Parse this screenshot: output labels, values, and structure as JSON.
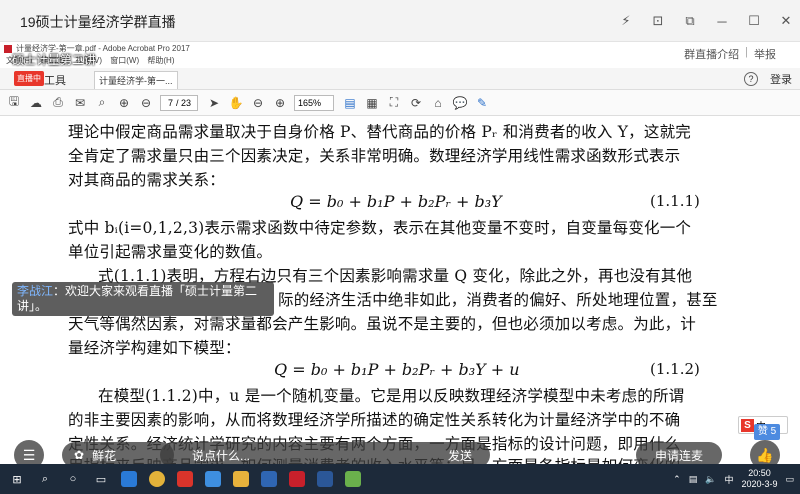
{
  "window": {
    "title": "19硕士计量经济学群直播",
    "controls": [
      "⚡",
      "⊡",
      "⧉",
      "─",
      "☐",
      "✕"
    ]
  },
  "acrobat": {
    "file_title": "计量经济学-第一章.pdf - Adobe Acrobat Pro 2017",
    "menu": [
      "文件(F)",
      "编辑(E)",
      "视图(V)",
      "窗口(W)",
      "帮助(H)"
    ],
    "stream_name": "硕士计量第二讲",
    "right_links": [
      "群直播介绍",
      "举报"
    ],
    "live_badge": "直播中",
    "tools_tab": "工具",
    "doc_tab": "计量经济学-第一...",
    "login": "登录",
    "page_current": "7",
    "page_total": "/ 23",
    "zoom": "165%"
  },
  "document": {
    "line1": "理论中假定商品需求量取决于自身价格 P、替代商品的价格 Pᵣ 和消费者的收入 Y，这就完",
    "line2": "全肯定了需求量只由三个因素决定，关系非常明确。数理经济学用线性需求函数形式表示",
    "line3": "对其商品的需求关系：",
    "eq1": "Q = b₀ + b₁P + b₂Pᵣ + b₃Y",
    "eq1_num": "(1.1.1)",
    "line4": "式中 bᵢ(i=0,1,2,3)表示需求函数中待定参数，表示在其他变量不变时，自变量每变化一个",
    "line5": "单位引起需求量变化的数值。",
    "line6": "式(1.1.1)表明，方程右边只有三个因素影响需求量 Q 变化，除此之外，再也没有其他",
    "line7": "际的经济生活中绝非如此，消费者的偏好、所处地理位置，甚至",
    "line8": "天气等偶然因素，对需求量都会产生影响。虽说不是主要的，但也必须加以考虑。为此，计",
    "line9": "量经济学构建如下模型：",
    "eq2": "Q = b₀ + b₁P + b₂Pᵣ + b₃Y + u",
    "eq2_num": "(1.1.2)",
    "line10": "在模型(1.1.2)中，u 是一个随机变量。它是用以反映数理经济学模型中未考虑的所谓",
    "line11": "的非主要因素的影响，从而将数理经济学所描述的确定性关系转化为计量经济学中的不确",
    "line12": "定性关系。经济统计学研究的内容主要有两个方面，一方面是指标的设计问题，即用什么",
    "line13": "用指标来反映商品需求，如何测量消费者的收入水平等；另一方面是各指标是如何变化的"
  },
  "chat": {
    "user": "李战江",
    "message": "：欢迎大家来观看直播「硕士计量第二讲」。"
  },
  "ime": {
    "label": "中",
    "extra": "·"
  },
  "likes": "赞 5",
  "bottom_bar": {
    "flower": "鲜花",
    "comment_placeholder": "说点什么...",
    "send": "发送",
    "connect": "申请连麦"
  },
  "taskbar": {
    "ime": "中",
    "time": "20:50",
    "date": "2020-3-9"
  },
  "colors": {
    "live_red": "#e8362b",
    "accent_blue": "#2a6fc9",
    "taskbar": "#1d2a3a"
  }
}
